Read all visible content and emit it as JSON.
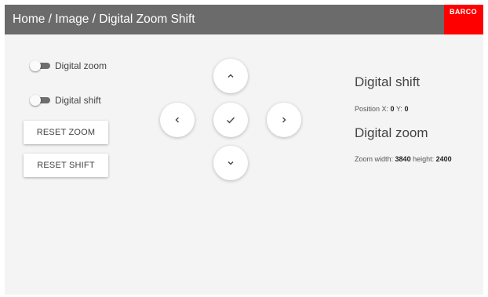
{
  "header": {
    "breadcrumb": "Home / Image / Digital Zoom Shift",
    "logo_text": "BARCO"
  },
  "toggles": [
    {
      "label": "Digital zoom",
      "on": false
    },
    {
      "label": "Digital shift",
      "on": false
    }
  ],
  "buttons": {
    "reset_zoom": "RESET ZOOM",
    "reset_shift": "RESET SHIFT"
  },
  "dpad": {
    "up_icon": "chevron-up-icon",
    "left_icon": "chevron-left-icon",
    "confirm_icon": "check-icon",
    "right_icon": "chevron-right-icon",
    "down_icon": "chevron-down-icon"
  },
  "shift": {
    "title": "Digital shift",
    "x_label": "Position X:",
    "x_value": "0",
    "y_label": "Y:",
    "y_value": "0"
  },
  "zoom": {
    "title": "Digital zoom",
    "width_label": "Zoom width:",
    "width_value": "3840",
    "height_label": "height:",
    "height_value": "2400"
  },
  "colors": {
    "header_bg": "#6b6b6b",
    "brand_red": "#ff0000",
    "panel_bg": "#f4f4f4"
  }
}
